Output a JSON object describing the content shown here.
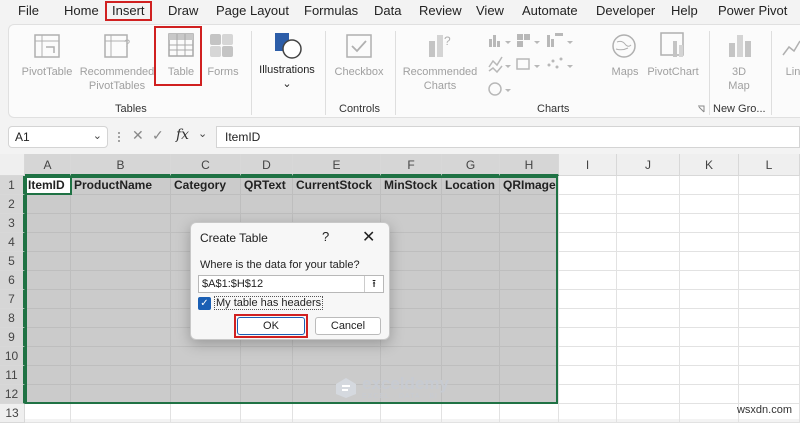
{
  "menu": {
    "tabs": [
      "File",
      "Home",
      "Insert",
      "Draw",
      "Page Layout",
      "Formulas",
      "Data",
      "Review",
      "View",
      "Automate",
      "Developer",
      "Help",
      "Power Pivot"
    ]
  },
  "ribbon": {
    "pivottable": "PivotTable",
    "recommended_pivot_1": "Recommended",
    "recommended_pivot_2": "PivotTables",
    "table": "Table",
    "forms": "Forms",
    "group_tables": "Tables",
    "illustrations": "Illustrations",
    "illustrations_arrow": "⌄",
    "checkbox": "Checkbox",
    "group_controls": "Controls",
    "recommended_charts_1": "Recommended",
    "recommended_charts_2": "Charts",
    "maps": "Maps",
    "pivotchart": "PivotChart",
    "map3d_1": "3D",
    "map3d_2": "Map",
    "group_charts": "Charts",
    "group_newgroup": "New Gro...",
    "lin": "Lin"
  },
  "formula_bar": {
    "name_box": "A1",
    "fx": "fx",
    "content": "ItemID"
  },
  "grid": {
    "columns": [
      "A",
      "B",
      "C",
      "D",
      "E",
      "F",
      "G",
      "H",
      "I",
      "J",
      "K",
      "L"
    ],
    "rows": [
      "1",
      "2",
      "3",
      "4",
      "5",
      "6",
      "7",
      "8",
      "9",
      "10",
      "11",
      "12",
      "13"
    ],
    "headers": [
      "ItemID",
      "ProductName",
      "Category",
      "QRText",
      "CurrentStock",
      "MinStock",
      "Location",
      "QRImage"
    ]
  },
  "dialog": {
    "title": "Create Table",
    "help": "?",
    "close": "✕",
    "prompt": "Where is the data for your table?",
    "range": "$A$1:$H$12",
    "has_headers_label": "My table has headers",
    "has_headers_checked": true,
    "ok": "OK",
    "cancel": "Cancel"
  },
  "watermark": {
    "name": "exceldemy",
    "tagline": "EXCEL · DATA · BI",
    "site": "wsxdn.com"
  },
  "colors": {
    "accent_green": "#1f7244",
    "highlight_red": "#d02020",
    "check_blue": "#1a5fb4"
  }
}
